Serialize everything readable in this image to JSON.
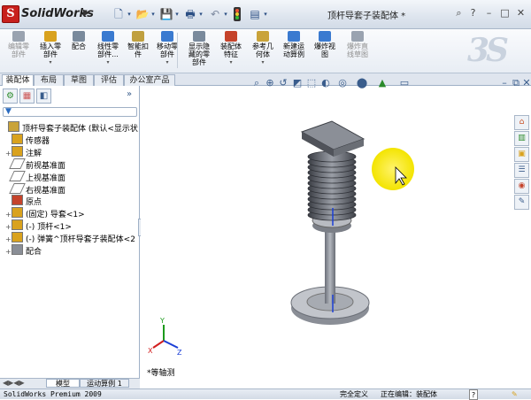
{
  "app": {
    "name": "SolidWorks",
    "document_title": "顶杆导套子装配体 *",
    "logo_letters": "S"
  },
  "quick_access": [
    "new-doc-icon",
    "open-icon",
    "save-icon",
    "print-icon",
    "undo-icon",
    "rebuild-icon",
    "options-icon"
  ],
  "command_manager": [
    {
      "label": "编辑零\n部件",
      "icon": "edit-component-icon",
      "enabled": false
    },
    {
      "label": "插入零\n部件",
      "icon": "insert-component-icon",
      "enabled": true,
      "dropdown": true
    },
    {
      "label": "配合",
      "icon": "mate-icon",
      "enabled": true
    },
    {
      "label": "线性零\n部件...",
      "icon": "linear-pattern-icon",
      "enabled": true,
      "dropdown": true
    },
    {
      "label": "智能扣\n件",
      "icon": "smart-fastener-icon",
      "enabled": true
    },
    {
      "label": "移动零\n部件",
      "icon": "move-component-icon",
      "enabled": true,
      "dropdown": true
    },
    {
      "label": "显示隐\n藏的零\n部件",
      "icon": "show-hidden-icon",
      "enabled": true
    },
    {
      "label": "装配体\n特征",
      "icon": "assembly-feature-icon",
      "enabled": true,
      "dropdown": true
    },
    {
      "label": "参考几\n何体",
      "icon": "reference-geometry-icon",
      "enabled": true,
      "dropdown": true
    },
    {
      "label": "新建运\n动算例",
      "icon": "new-motion-study-icon",
      "enabled": true
    },
    {
      "label": "爆炸视\n图",
      "icon": "exploded-view-icon",
      "enabled": true
    },
    {
      "label": "爆炸直\n线草图",
      "icon": "explode-line-sketch-icon",
      "enabled": false
    }
  ],
  "tabs": [
    {
      "label": "装配体",
      "active": true
    },
    {
      "label": "布局",
      "active": false
    },
    {
      "label": "草图",
      "active": false
    },
    {
      "label": "评估",
      "active": false
    },
    {
      "label": "办公室产品",
      "active": false
    }
  ],
  "feature_tree": [
    {
      "label": "顶杆导套子装配体  (默认<显示状",
      "icon": "assembly-icon",
      "indent": 0,
      "expander": ""
    },
    {
      "label": "传感器",
      "icon": "sensor-icon",
      "indent": 1,
      "expander": ""
    },
    {
      "label": "注解",
      "icon": "annotation-icon",
      "indent": 1,
      "expander": "+"
    },
    {
      "label": "前视基准面",
      "icon": "plane-icon",
      "indent": 1,
      "expander": ""
    },
    {
      "label": "上视基准面",
      "icon": "plane-icon",
      "indent": 1,
      "expander": ""
    },
    {
      "label": "右视基准面",
      "icon": "plane-icon",
      "indent": 1,
      "expander": ""
    },
    {
      "label": "原点",
      "icon": "origin-icon",
      "indent": 1,
      "expander": ""
    },
    {
      "label": "(固定) 导套<1>",
      "icon": "part-icon",
      "indent": 1,
      "expander": "+"
    },
    {
      "label": "(-) 顶杆<1>",
      "icon": "part-icon",
      "indent": 1,
      "expander": "+"
    },
    {
      "label": "(-) 弹簧^顶杆导套子装配体<2",
      "icon": "part-icon",
      "indent": 1,
      "expander": "+"
    },
    {
      "label": "配合",
      "icon": "mates-folder-icon",
      "indent": 1,
      "expander": "+"
    }
  ],
  "viewport": {
    "view_label": "*等轴测"
  },
  "bottom_tabs": [
    "模型",
    "运动算例 1"
  ],
  "status": {
    "product": "SolidWorks Premium 2009",
    "definition": "完全定义",
    "editing": "正在编辑：装配体",
    "help": "?"
  },
  "colors": {
    "accent": "#c8201c",
    "toolbar_blue": "#2b4f84",
    "highlight": "#f5ee10"
  }
}
